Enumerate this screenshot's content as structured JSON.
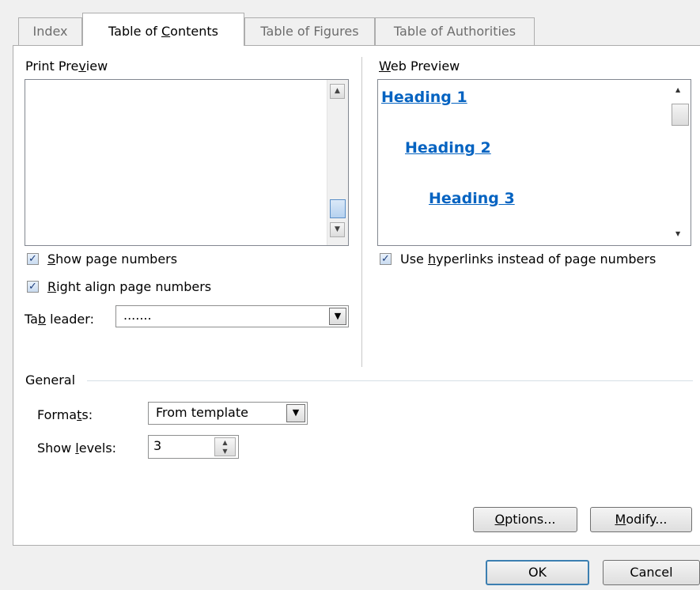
{
  "tabs": [
    {
      "label": "Index",
      "hotkey": "",
      "rest": "",
      "active": false
    },
    {
      "label": "Table of ",
      "hotkey": "C",
      "rest": "ontents",
      "active": true
    },
    {
      "label": "Table of Figures",
      "hotkey": "",
      "rest": "",
      "active": false
    },
    {
      "label": "Table of Authorities",
      "hotkey": "",
      "rest": "",
      "active": false
    }
  ],
  "print_preview": {
    "title_pre": "Print Pre",
    "title_key": "v",
    "title_post": "iew",
    "scroll_up_icon": "scroll-up-arrow",
    "scroll_down_icon": "scroll-down-arrow"
  },
  "web_preview": {
    "title_key": "W",
    "title_post": "eb Preview",
    "headings": [
      "Heading 1",
      "Heading 2",
      "Heading 3"
    ],
    "link_color": "#0563c1"
  },
  "options": {
    "show_page_numbers": {
      "key": "S",
      "post": "how page numbers",
      "checked": true
    },
    "right_align": {
      "key": "R",
      "post": "ight align page numbers",
      "checked": true
    },
    "use_hyperlinks": {
      "pre": "Use ",
      "key": "h",
      "post": "yperlinks instead of page numbers",
      "checked": true
    },
    "tab_leader": {
      "pre": "Ta",
      "key": "b",
      "post": " leader:",
      "value": "......."
    }
  },
  "general": {
    "title": "General",
    "formats": {
      "pre": "Forma",
      "key": "t",
      "post": "s:",
      "value": "From template"
    },
    "show_levels": {
      "pre": "Show ",
      "key": "l",
      "post": "evels:",
      "value": "3"
    }
  },
  "buttons": {
    "options": {
      "key": "O",
      "post": "ptions..."
    },
    "modify": {
      "key": "M",
      "post": "odify..."
    },
    "ok": "OK",
    "cancel": "Cancel"
  },
  "colors": {
    "accent": "#3c7fb1",
    "panel": "#ffffff",
    "dialog": "#f0f0f0"
  }
}
